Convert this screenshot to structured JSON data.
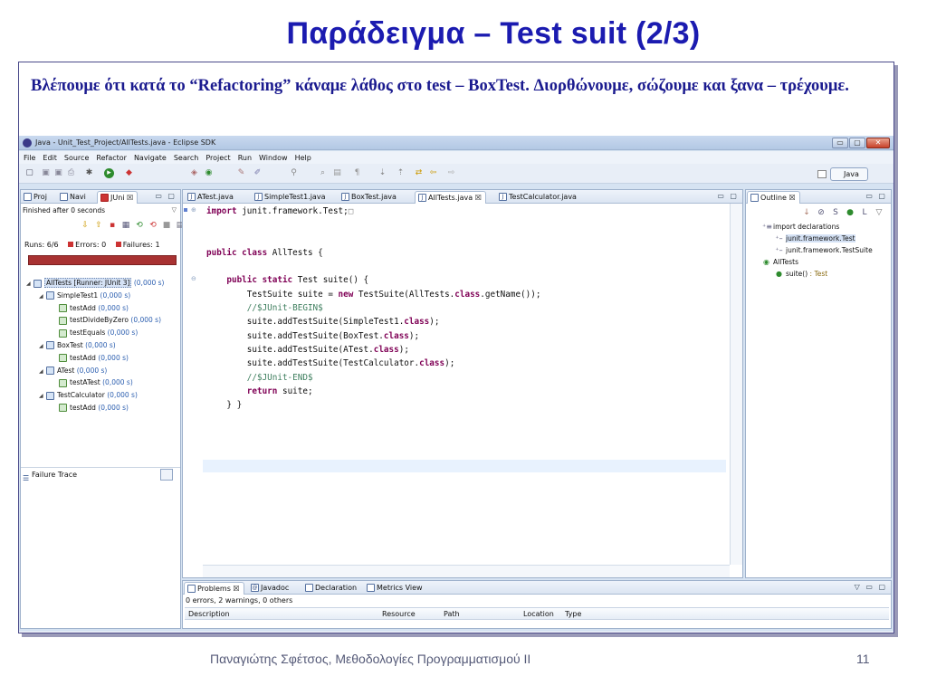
{
  "slide": {
    "title": "Παράδειγμα – Test suit  (2/3)",
    "text": "Βλέπουμε ότι κατά το “Refactoring” κάναμε λάθος στο test – BoxTest.  Διορθώνουμε, σώζουμε και ξανα – τρέχουμε.",
    "footer_author": "Παναγιώτης Σφέτσος,  Μεθοδολογίες Προγραμματισμού ΙΙ",
    "page_number": "11"
  },
  "window": {
    "title": "Java - Unit_Test_Project/AllTests.java - Eclipse SDK",
    "controls": [
      "▭",
      "▢",
      "✕"
    ]
  },
  "menu": [
    "File",
    "Edit",
    "Source",
    "Refactor",
    "Navigate",
    "Search",
    "Project",
    "Run",
    "Window",
    "Help"
  ],
  "perspective": {
    "label": "Java"
  },
  "left_panel": {
    "tabs": [
      "Proj",
      "Navi",
      "JUni"
    ],
    "status": "Finished after 0 seconds",
    "runs_label": "Runs:",
    "runs_value": "6/6",
    "errors_label": "Errors:",
    "errors_value": "0",
    "failures_label": "Failures:",
    "failures_value": "1",
    "failure_trace_label": "Failure Trace",
    "tree": [
      {
        "label": "AllTests [Runner: JUnit 3]",
        "time": "(0,000 s)",
        "level": 0,
        "kind": "suite"
      },
      {
        "label": "SimpleTest1",
        "time": "(0,000 s)",
        "level": 1,
        "kind": "suite"
      },
      {
        "label": "testAdd",
        "time": "(0,000 s)",
        "level": 2,
        "kind": "test"
      },
      {
        "label": "testDivideByZero",
        "time": "(0,000 s)",
        "level": 2,
        "kind": "test"
      },
      {
        "label": "testEquals",
        "time": "(0,000 s)",
        "level": 2,
        "kind": "test"
      },
      {
        "label": "BoxTest",
        "time": "(0,000 s)",
        "level": 1,
        "kind": "suite"
      },
      {
        "label": "testAdd",
        "time": "(0,000 s)",
        "level": 2,
        "kind": "test"
      },
      {
        "label": "ATest",
        "time": "(0,000 s)",
        "level": 1,
        "kind": "suite"
      },
      {
        "label": "testATest",
        "time": "(0,000 s)",
        "level": 2,
        "kind": "test"
      },
      {
        "label": "TestCalculator",
        "time": "(0,000 s)",
        "level": 1,
        "kind": "suite"
      },
      {
        "label": "testAdd",
        "time": "(0,000 s)",
        "level": 2,
        "kind": "test"
      }
    ]
  },
  "editor": {
    "tabs": [
      "ATest.java",
      "SimpleTest1.java",
      "BoxTest.java",
      "AllTests.java",
      "TestCalculator.java"
    ],
    "active_tab": "AllTests.java",
    "code": [
      [
        [
          "kw",
          "import"
        ],
        [
          "",
          " junit.framework.Test;"
        ]
      ],
      [
        [
          "",
          ""
        ]
      ],
      [
        [
          "",
          ""
        ]
      ],
      [
        [
          "kw",
          "public class"
        ],
        [
          "",
          " AllTests {"
        ]
      ],
      [
        [
          "",
          ""
        ]
      ],
      [
        [
          "",
          "    "
        ],
        [
          "kw",
          "public static"
        ],
        [
          "",
          " Test suite() {"
        ]
      ],
      [
        [
          "",
          "        TestSuite suite = "
        ],
        [
          "kw",
          "new"
        ],
        [
          "",
          " TestSuite(AllTests."
        ],
        [
          "kw",
          "class"
        ],
        [
          "",
          ".getName());"
        ]
      ],
      [
        [
          "cm",
          "        //$JUnit-BEGIN$"
        ]
      ],
      [
        [
          "",
          "        suite.addTestSuite(SimpleTest1."
        ],
        [
          "kw",
          "class"
        ],
        [
          "",
          ");"
        ]
      ],
      [
        [
          "",
          "        suite.addTestSuite(BoxTest."
        ],
        [
          "kw",
          "class"
        ],
        [
          "",
          ");"
        ]
      ],
      [
        [
          "",
          "        suite.addTestSuite(ATest."
        ],
        [
          "kw",
          "class"
        ],
        [
          "",
          ");"
        ]
      ],
      [
        [
          "",
          "        suite.addTestSuite(TestCalculator."
        ],
        [
          "kw",
          "class"
        ],
        [
          "",
          ");"
        ]
      ],
      [
        [
          "cm",
          "        //$JUnit-END$"
        ]
      ],
      [
        [
          "",
          "        "
        ],
        [
          "kw",
          "return"
        ],
        [
          "",
          " suite;"
        ]
      ],
      [
        [
          "",
          "    } }"
        ]
      ]
    ]
  },
  "outline": {
    "tab": "Outline",
    "items": [
      {
        "label": "import declarations",
        "level": 0,
        "icon": "imports-icon"
      },
      {
        "label": "junit.framework.Test",
        "level": 1,
        "icon": "import-icon",
        "selected": true
      },
      {
        "label": "junit.framework.TestSuite",
        "level": 1,
        "icon": "import-icon"
      },
      {
        "label": "AllTests",
        "level": 0,
        "icon": "class-icon"
      },
      {
        "label": "suite()",
        "type": " : Test",
        "level": 1,
        "icon": "method-icon"
      }
    ]
  },
  "bottom": {
    "tabs": [
      "Problems",
      "Javadoc",
      "Declaration",
      "Metrics View"
    ],
    "summary": "0 errors, 2 warnings, 0 others",
    "columns": [
      "Description",
      "Resource",
      "Path",
      "Location",
      "Type"
    ]
  },
  "colors": {
    "title": "#1b1bb0",
    "failure_bar": "#a83232",
    "keyword": "#7f0055",
    "comment": "#3f7f5f"
  }
}
